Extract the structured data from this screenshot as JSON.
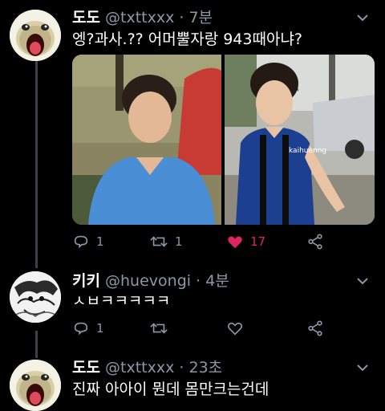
{
  "tweets": [
    {
      "name": "도도",
      "handle": "@txttxxx",
      "time": "7분",
      "text": "엥?과사.?? 어머뿔자랑 943때아냐?",
      "actions": {
        "replies": "1",
        "retweets": "1",
        "likes": "17",
        "liked": true
      }
    },
    {
      "name": "키키",
      "handle": "@huevongi",
      "time": "4분",
      "text": "ㅅㅂㅋㅋㅋㅋㅋ",
      "actions": {
        "replies": "1",
        "retweets": "",
        "likes": ""
      }
    },
    {
      "name": "도도",
      "handle": "@txttxxx",
      "time": "23초",
      "text": "진짜 아아이 뭔데 몸만크는건데"
    }
  ],
  "media": {
    "watermark": "kaihuenng"
  },
  "icons": {
    "reply": "reply-icon",
    "retweet": "retweet-icon",
    "like": "heart-icon",
    "share": "share-icon",
    "more": "chevron-down-icon"
  },
  "colors": {
    "muted": "#8b98a5",
    "like": "#e0245e",
    "background": "#000000"
  }
}
